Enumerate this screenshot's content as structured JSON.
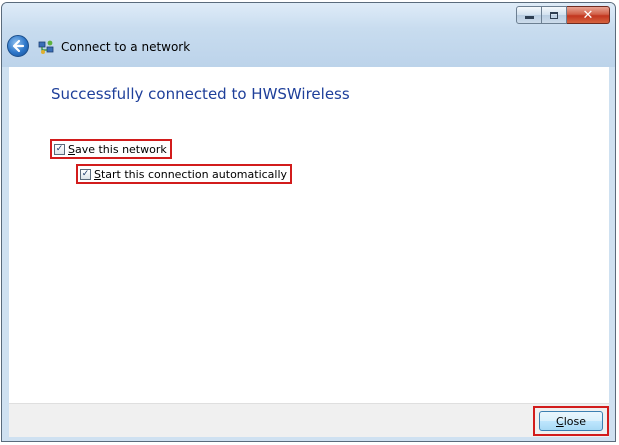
{
  "window": {
    "title": "Connect to a network",
    "caption_buttons": [
      "minimize",
      "maximize",
      "close"
    ],
    "close_glyph": "✕"
  },
  "content": {
    "heading": "Successfully connected to HWSWireless",
    "save_network": {
      "mnemonic": "S",
      "rest": "ave this network",
      "checked": true
    },
    "start_automatically": {
      "mnemonic": "S",
      "rest": "tart this connection automatically",
      "checked": true
    }
  },
  "footer": {
    "close_button": {
      "mnemonic": "C",
      "rest": "lose"
    }
  },
  "icons": {
    "back": "back-arrow-icon",
    "network": "network-icon",
    "check_glyph": "✓"
  },
  "colors": {
    "heading": "#1e3f9a",
    "highlight": "#d21c1c"
  }
}
